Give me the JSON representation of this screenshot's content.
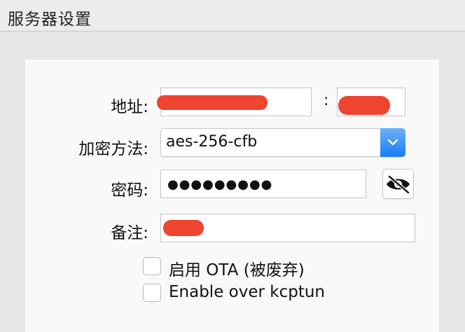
{
  "window": {
    "title": "服务器设置"
  },
  "form": {
    "address_label": "地址:",
    "address_value": "",
    "port_separator": ":",
    "port_value": "",
    "method_label": "加密方法:",
    "method_value": "aes-256-cfb",
    "password_label": "密码:",
    "password_value": "●●●●●●●●●",
    "remark_label": "备注:",
    "remark_value": ""
  },
  "options": {
    "ota_label": "启用 OTA (被废弃)",
    "ota_checked": false,
    "kcptun_label": "Enable over kcptun",
    "kcptun_checked": false
  },
  "icons": {
    "select_arrow": "chevron-down-icon",
    "password_toggle": "eye-slash-icon"
  },
  "colors": {
    "accent": "#1a7cf5",
    "redaction": "#ee4530"
  }
}
